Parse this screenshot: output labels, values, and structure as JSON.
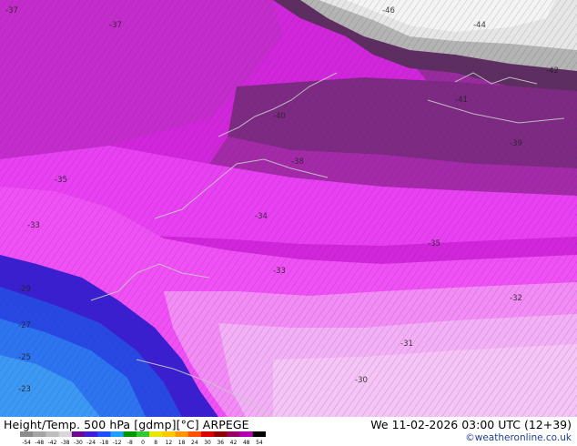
{
  "footer": {
    "title": "Height/Temp. 500 hPa [gdmp][°C] ARPEGE",
    "datetime": "We 11-02-2026 03:00 UTC (12+39)",
    "credit": "©weatheronline.co.uk"
  },
  "colorbar": {
    "ticks": [
      "-54",
      "-48",
      "-42",
      "-38",
      "-30",
      "-24",
      "-18",
      "-12",
      "-8",
      "0",
      "8",
      "12",
      "18",
      "24",
      "30",
      "36",
      "42",
      "48",
      "54"
    ],
    "colors": [
      "#8c8c8c",
      "#a5a5a5",
      "#bebebe",
      "#d7d7d7",
      "#6e0a8c",
      "#3c1edc",
      "#1e50ff",
      "#1ea0ff",
      "#009600",
      "#32c832",
      "#e6e600",
      "#ffc800",
      "#ff9600",
      "#ff5000",
      "#dc0000",
      "#8c0000",
      "#960064",
      "#b400b4",
      "#000000"
    ]
  },
  "map": {
    "bands": [
      {
        "temp": "-46",
        "color": "#f2f2f2"
      },
      {
        "temp": "-44",
        "color": "#e4e4e4"
      },
      {
        "temp": "-42",
        "color": "#b8b8b8"
      },
      {
        "temp": "-41",
        "color": "#5a2a5c"
      },
      {
        "temp": "-40",
        "color": "#6e2a72"
      },
      {
        "temp": "-39",
        "color": "#8a2a8e"
      },
      {
        "temp": "-38",
        "color": "#a52aaa"
      },
      {
        "temp": "-37",
        "color": "#c21ec8"
      },
      {
        "temp": "-35",
        "color": "#dc32e6"
      },
      {
        "temp": "-34",
        "color": "#ea3cf4"
      },
      {
        "temp": "-33",
        "color": "#f04ef8"
      },
      {
        "temp": "-32",
        "color": "#f57cf8"
      },
      {
        "temp": "-31",
        "color": "#f4a2f6"
      },
      {
        "temp": "-30",
        "color": "#f3b8f4"
      },
      {
        "temp": "-29",
        "color": "#3c14c8"
      },
      {
        "temp": "-27",
        "color": "#2d3cdc"
      },
      {
        "temp": "-25",
        "color": "#2864f0"
      },
      {
        "temp": "-23",
        "color": "#3c96f5"
      }
    ]
  }
}
